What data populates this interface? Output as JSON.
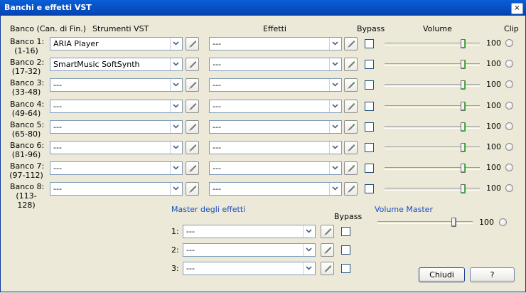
{
  "window": {
    "title": "Banchi e effetti VST",
    "close_glyph": "×"
  },
  "headers": {
    "bank": "Banco (Can. di Fin.)",
    "instruments": "Strumenti VST",
    "effects": "Effetti",
    "bypass": "Bypass",
    "volume": "Volume",
    "clip": "Clip"
  },
  "banks": [
    {
      "name": "Banco 1:",
      "range": "(1-16)",
      "instrument": "ARIA Player",
      "effect": "---",
      "volume": "100",
      "volume_fraction": 1.0
    },
    {
      "name": "Banco 2:",
      "range": "(17-32)",
      "instrument": "SmartMusic SoftSynth",
      "effect": "---",
      "volume": "100",
      "volume_fraction": 1.0
    },
    {
      "name": "Banco 3:",
      "range": "(33-48)",
      "instrument": "---",
      "effect": "---",
      "volume": "100",
      "volume_fraction": 1.0
    },
    {
      "name": "Banco 4:",
      "range": "(49-64)",
      "instrument": "---",
      "effect": "---",
      "volume": "100",
      "volume_fraction": 1.0
    },
    {
      "name": "Banco 5:",
      "range": "(65-80)",
      "instrument": "---",
      "effect": "---",
      "volume": "100",
      "volume_fraction": 1.0
    },
    {
      "name": "Banco 6:",
      "range": "(81-96)",
      "instrument": "---",
      "effect": "---",
      "volume": "100",
      "volume_fraction": 1.0
    },
    {
      "name": "Banco 7:",
      "range": "(97-112)",
      "instrument": "---",
      "effect": "---",
      "volume": "100",
      "volume_fraction": 1.0
    },
    {
      "name": "Banco 8:",
      "range": "(113-128)",
      "instrument": "---",
      "effect": "---",
      "volume": "100",
      "volume_fraction": 1.0
    }
  ],
  "master": {
    "title": "Master degli effetti",
    "bypass": "Bypass",
    "slots": [
      {
        "label": "1:",
        "effect": "---"
      },
      {
        "label": "2:",
        "effect": "---"
      },
      {
        "label": "3:",
        "effect": "---"
      }
    ]
  },
  "master_volume": {
    "title": "Volume Master",
    "value": "100",
    "volume_fraction": 0.8
  },
  "buttons": {
    "close": "Chiudi",
    "help": "?"
  },
  "colors": {
    "titlebar": "#0853c6",
    "accent_text": "#1a4ec1",
    "dialog_bg": "#ece9d8"
  },
  "icons": {
    "edit": "edit-pencil-icon",
    "dropdown": "chevron-down-icon",
    "clip": "clip-led-icon"
  }
}
